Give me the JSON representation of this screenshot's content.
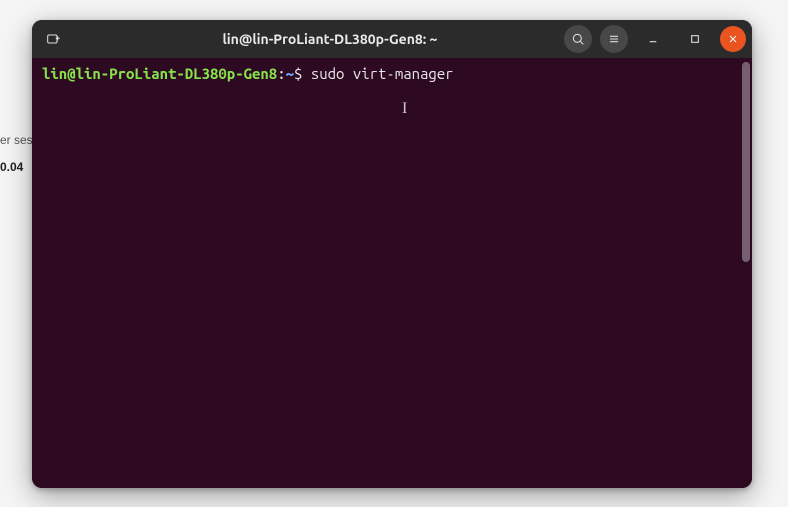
{
  "background": {
    "frag1": "er ses",
    "frag2": "0.04"
  },
  "titlebar": {
    "title": "lin@lin-ProLiant-DL380p-Gen8: ~"
  },
  "terminal": {
    "prompt_user_host": "lin@lin-ProLiant-DL380p-Gen8",
    "prompt_sep": ":",
    "prompt_path": "~",
    "prompt_symbol": "$",
    "command": "sudo virt-manager"
  },
  "icons": {
    "newtab": "new-tab-icon",
    "search": "search-icon",
    "menu": "menu-icon",
    "minimize": "minimize-icon",
    "maximize": "maximize-icon",
    "close": "close-icon"
  }
}
